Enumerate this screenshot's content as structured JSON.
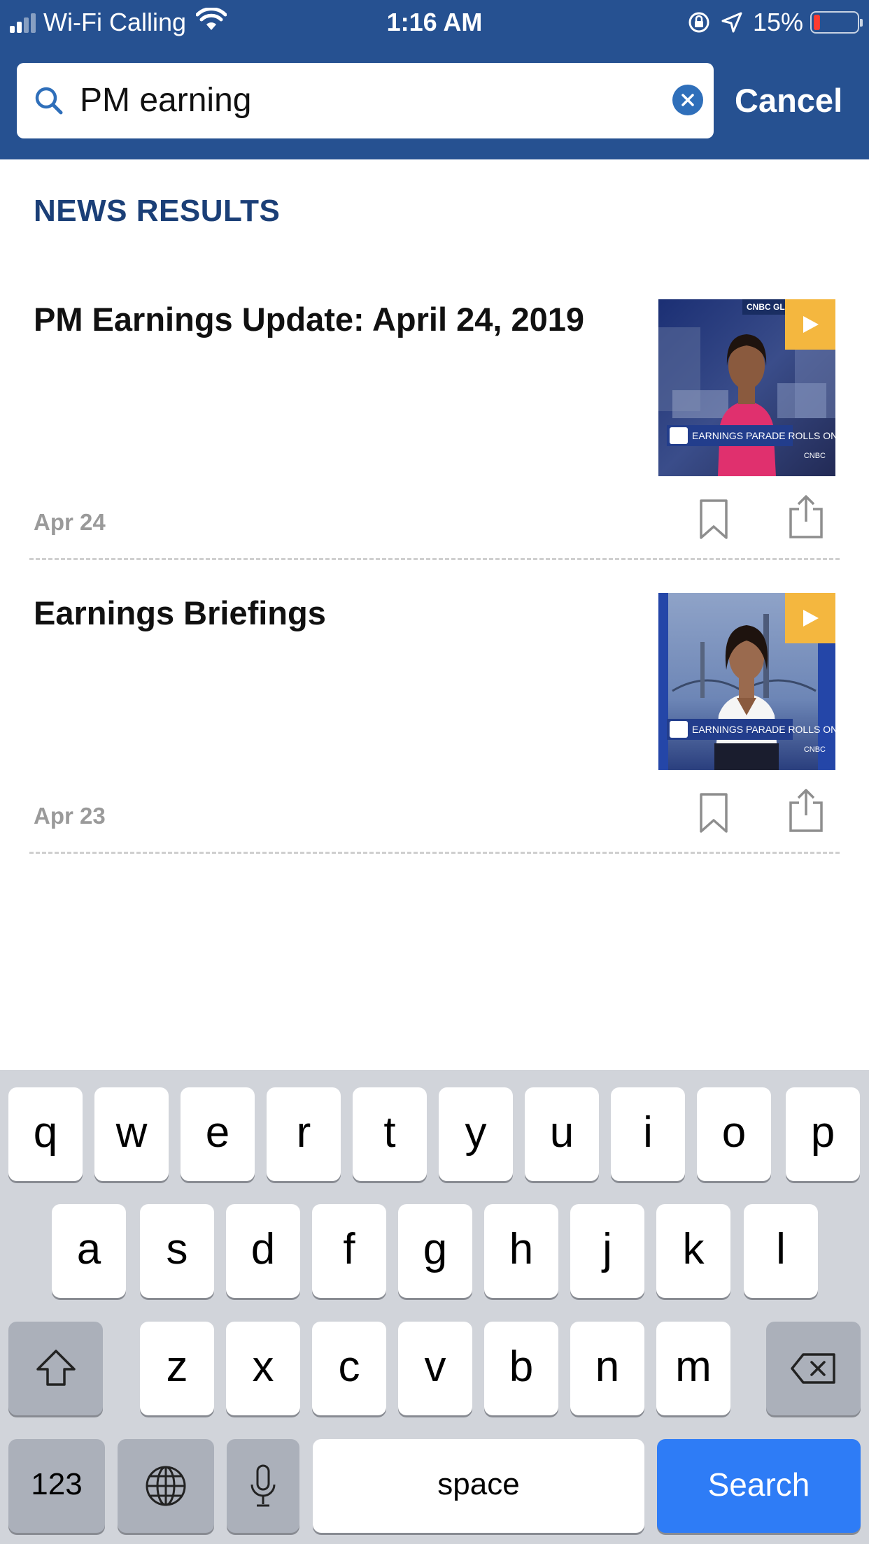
{
  "status_bar": {
    "carrier": "Wi-Fi Calling",
    "time": "1:16 AM",
    "battery_percent": "15%",
    "battery_level": 0.15,
    "battery_color": "#ff3b30"
  },
  "colors": {
    "header": "#265191",
    "section_title": "#1b3f77",
    "search_key": "#2e7cf6",
    "play_badge": "#f4b73f"
  },
  "search": {
    "value": "PM earning",
    "cancel_label": "Cancel"
  },
  "results": {
    "section_title": "NEWS RESULTS",
    "articles": [
      {
        "headline": "PM Earnings Update: April 24, 2019",
        "date": "Apr 24",
        "thumb_banner": "EARNINGS PARADE ROLLS ON",
        "thumb_top": "CNBC GLOBAL",
        "thumb_logo": "CNBC"
      },
      {
        "headline": "Earnings Briefings",
        "date": "Apr 23",
        "thumb_banner": "EARNINGS PARADE ROLLS ON",
        "thumb_logo": "CNBC"
      }
    ]
  },
  "keyboard": {
    "row1": [
      "q",
      "w",
      "e",
      "r",
      "t",
      "y",
      "u",
      "i",
      "o",
      "p"
    ],
    "row2": [
      "a",
      "s",
      "d",
      "f",
      "g",
      "h",
      "j",
      "k",
      "l"
    ],
    "row3": [
      "z",
      "x",
      "c",
      "v",
      "b",
      "n",
      "m"
    ],
    "numbers_label": "123",
    "space_label": "space",
    "search_label": "Search"
  }
}
